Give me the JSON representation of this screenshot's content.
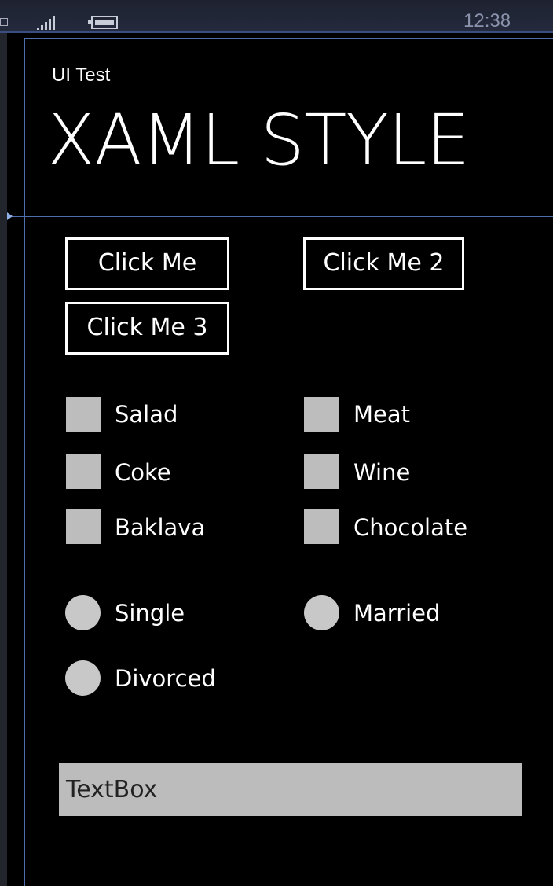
{
  "status_bar": {
    "time": "12:38",
    "signal_icon": "signal-strength-icon",
    "battery_icon": "battery-icon"
  },
  "app": {
    "subtitle": "UI Test",
    "title": "XAML STYLE"
  },
  "buttons": {
    "button1": "Click Me",
    "button2": "Click Me 2",
    "button3": "Click Me 3"
  },
  "checkboxes": [
    {
      "label": "Salad"
    },
    {
      "label": "Meat"
    },
    {
      "label": "Coke"
    },
    {
      "label": "Wine"
    },
    {
      "label": "Baklava"
    },
    {
      "label": "Chocolate"
    }
  ],
  "radios": [
    {
      "label": "Single"
    },
    {
      "label": "Married"
    },
    {
      "label": "Divorced"
    }
  ],
  "textbox": {
    "value": "TextBox"
  },
  "colors": {
    "background": "#000000",
    "control_fill": "#bdbdbd",
    "designer_guide": "#4d6fb0"
  }
}
